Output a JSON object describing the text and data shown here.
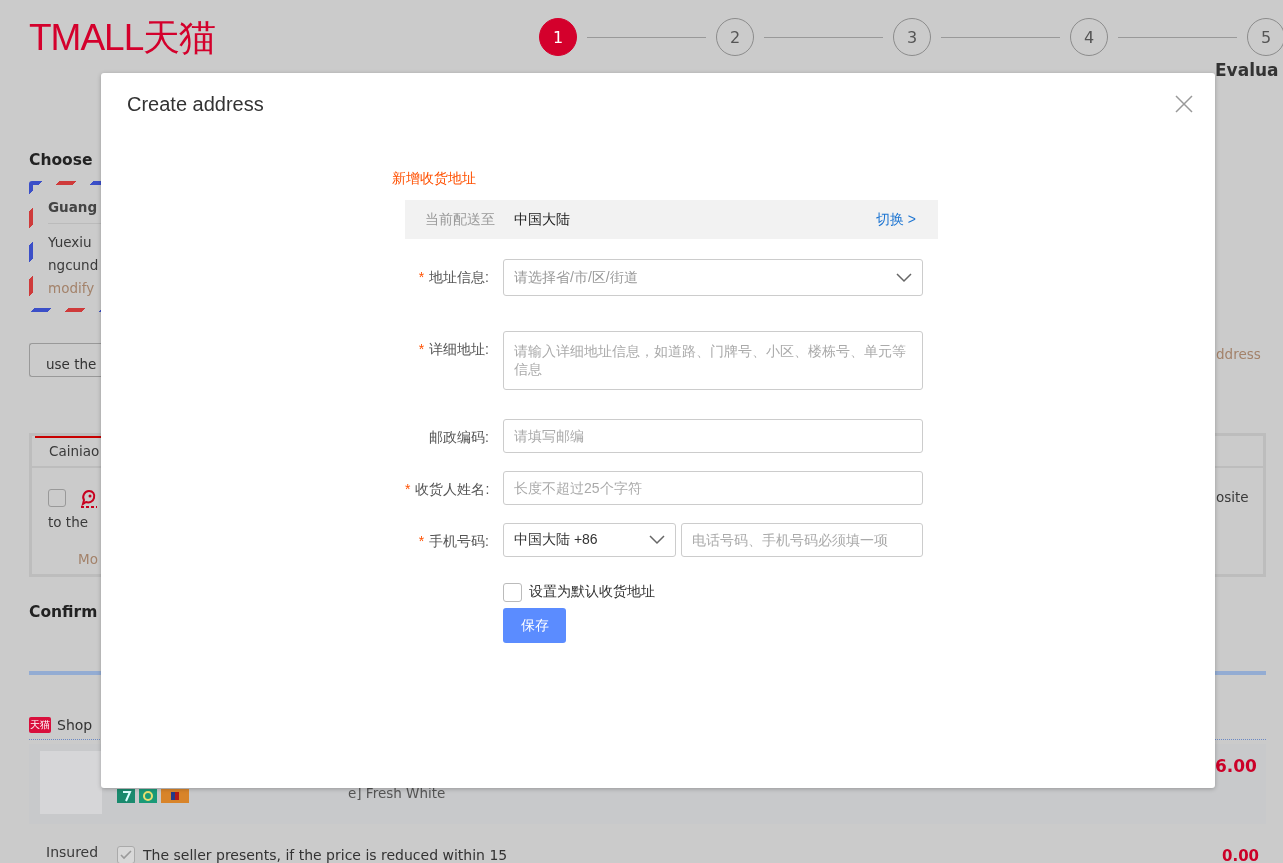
{
  "logo": "TMALL天猫",
  "steps": [
    {
      "number": "1",
      "selected": true
    },
    {
      "number": "2",
      "selected": false
    },
    {
      "number": "3",
      "selected": false
    },
    {
      "number": "4",
      "selected": false
    },
    {
      "number": "5",
      "selected": false,
      "label": "Evalua"
    }
  ],
  "page": {
    "choose_heading": "Choose",
    "address_card": {
      "title": "Guang",
      "lines": [
        "Yuexiu",
        "ngcund"
      ],
      "link": "modify"
    },
    "use_button": "use the",
    "manage_link": "ddress",
    "delivery": {
      "tabs": [
        {
          "label": "Cainiao",
          "selected": true
        }
      ],
      "checked": false,
      "text": "to the",
      "right_text": "osite",
      "more_link": "Mo"
    },
    "confirm_heading": "Confirm",
    "shop": {
      "badge": "天猫",
      "name": "Shop"
    },
    "product": {
      "spec": "e] Fresh White",
      "price": "6.00"
    },
    "insurance": {
      "label": "Insured",
      "checked": true,
      "text": "The seller presents, if the price is reduced within 15",
      "price": "0.00"
    }
  },
  "dialog": {
    "title": "Create address",
    "heading": "新增收货地址",
    "region": {
      "label": "当前配送至",
      "value": "中国大陆",
      "link": "切换 >"
    },
    "fields": [
      {
        "kind": "select",
        "required_mark": "*",
        "label": "地址信息:",
        "placeholder": "请选择省/市/区/街道"
      },
      {
        "kind": "textarea",
        "required_mark": "*",
        "label": "详细地址:",
        "placeholder": "请输入详细地址信息，如道路、门牌号、小区、楼栋号、单元等信息"
      },
      {
        "kind": "input",
        "label": "邮政编码:",
        "placeholder": "请填写邮编"
      },
      {
        "kind": "input",
        "required_mark": "*",
        "label": "收货人姓名:",
        "placeholder": "长度不超过25个字符"
      },
      {
        "kind": "phone",
        "required_mark": "*",
        "label": "手机号码:",
        "value": "中国大陆 +86",
        "placeholder": "电话号码、手机号码必须填一项"
      }
    ],
    "default_checkbox": {
      "label": "设置为默认收货地址",
      "checked": false
    },
    "save_button": "保存"
  }
}
